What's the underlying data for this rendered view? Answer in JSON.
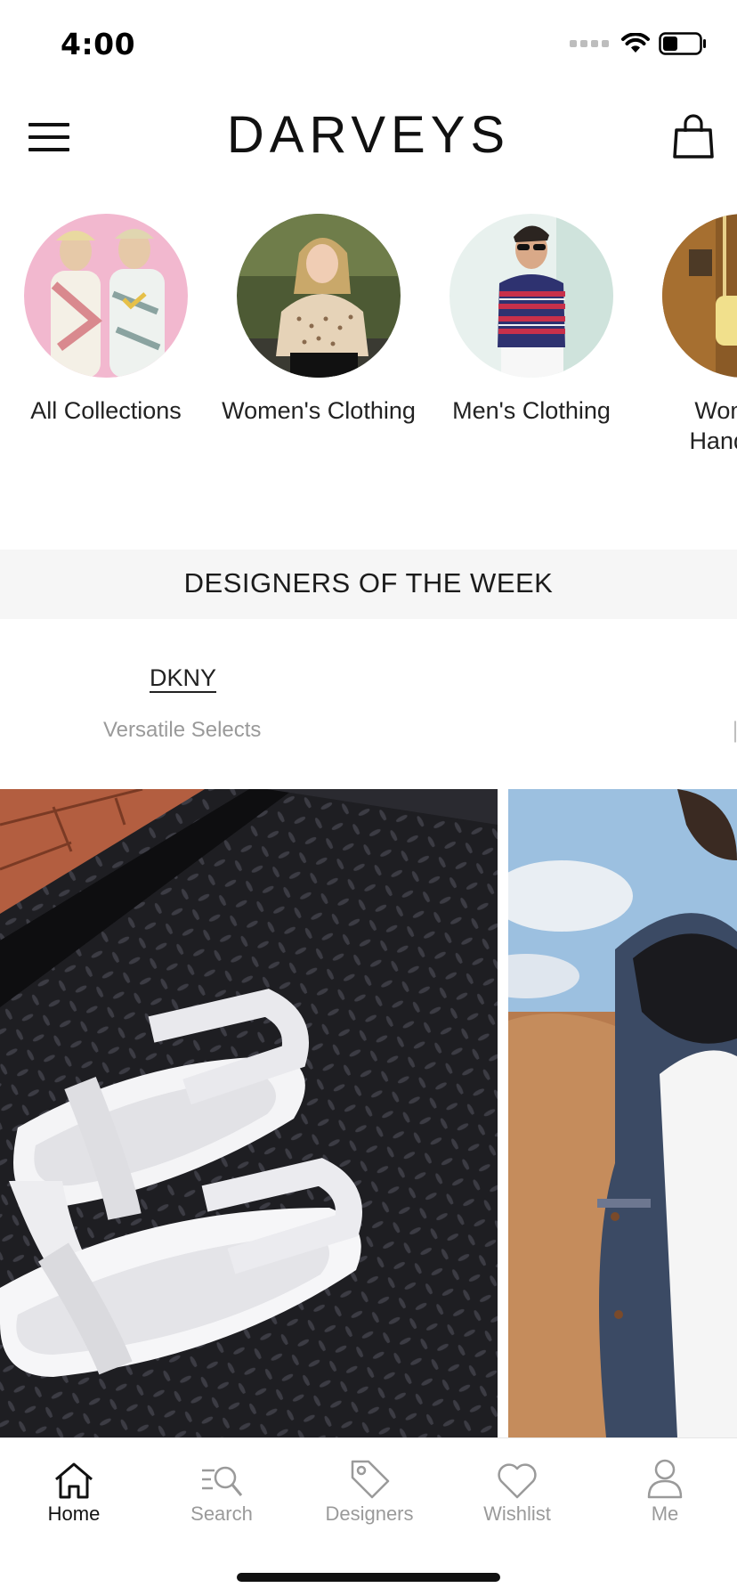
{
  "status_bar": {
    "time": "4:00"
  },
  "header": {
    "brand": "DARVEYS"
  },
  "categories": [
    {
      "label": "All Collections"
    },
    {
      "label": "Women's Clothing"
    },
    {
      "label": "Men's Clothing"
    },
    {
      "label": "Women's Handbags"
    }
  ],
  "designers_section": {
    "title": "DESIGNERS OF THE WEEK",
    "featured": {
      "name": "DKNY",
      "tagline": "Versatile Selects"
    }
  },
  "tabs": [
    {
      "label": "Home",
      "icon": "home-icon",
      "active": true
    },
    {
      "label": "Search",
      "icon": "search-icon",
      "active": false
    },
    {
      "label": "Designers",
      "icon": "tag-icon",
      "active": false
    },
    {
      "label": "Wishlist",
      "icon": "heart-icon",
      "active": false
    },
    {
      "label": "Me",
      "icon": "user-icon",
      "active": false
    }
  ],
  "colors": {
    "active_tab": "#111111",
    "inactive_tab": "#9a9a9a",
    "band_background": "#f6f6f6"
  }
}
